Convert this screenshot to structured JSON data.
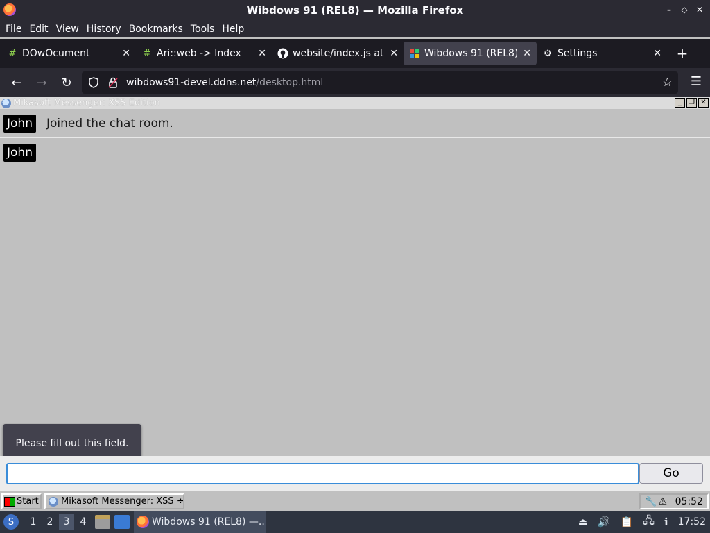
{
  "window": {
    "title": "Wibdows 91 (REL8) — Mozilla Firefox",
    "controls": [
      "–",
      "◇",
      "✕"
    ]
  },
  "menu": [
    "File",
    "Edit",
    "View",
    "History",
    "Bookmarks",
    "Tools",
    "Help"
  ],
  "tabs": [
    {
      "label": "DOwOcument",
      "icon": "hash-icon",
      "active": false
    },
    {
      "label": "Ari::web -> Index",
      "icon": "hash-icon",
      "active": false
    },
    {
      "label": "website/index.js at te",
      "icon": "github-icon",
      "active": false
    },
    {
      "label": "Wibdows 91 (REL8)",
      "icon": "wibdows-icon",
      "active": true
    },
    {
      "label": "Settings",
      "icon": "gear-icon",
      "active": false
    }
  ],
  "urlbar": {
    "host": "wibdows91-devel.ddns.net",
    "path": "/desktop.html"
  },
  "app": {
    "title": "Mikasoft Messenger: XSS Edition",
    "messages": [
      {
        "user": "John",
        "text": "Joined the chat room."
      },
      {
        "user": "John",
        "text": ""
      }
    ],
    "tooltip": "Please fill out this field.",
    "input_value": "",
    "go_label": "Go"
  },
  "win_taskbar": {
    "start_label": "Start",
    "task_label": "Mikasoft Messenger: XSS ÷",
    "clock": "05:52"
  },
  "panel": {
    "workspaces": [
      "1",
      "2",
      "3",
      "4"
    ],
    "active_workspace": "3",
    "task_label": "Wibdows 91 (REL8) —...",
    "clock": "17:52"
  },
  "colors": {
    "firefox_chrome": "#2b2a33",
    "tabstrip": "#1c1b22",
    "page_bg": "#c0c0c0",
    "input_focus": "#3a8dd9",
    "panel_bg": "#2e3440"
  }
}
